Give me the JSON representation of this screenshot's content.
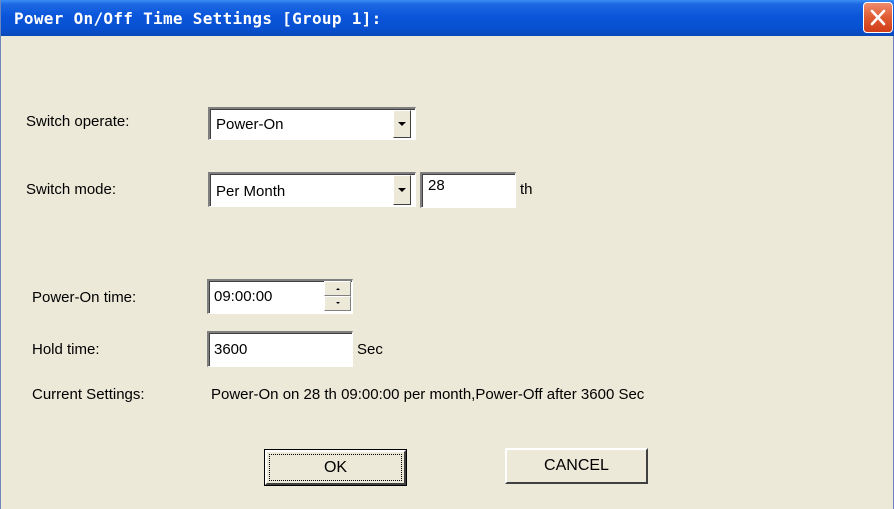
{
  "window": {
    "title": "Power On/Off Time Settings [Group 1]:"
  },
  "form": {
    "switch_operate_label": "Switch operate:",
    "switch_operate_value": "Power-On",
    "switch_mode_label": "Switch  mode:",
    "switch_mode_value": "Per Month",
    "day_value": "28",
    "day_suffix": "th",
    "power_on_time_label": "Power-On time:",
    "power_on_time_value": "09:00:00",
    "hold_time_label": "Hold time:",
    "hold_time_value": "3600",
    "hold_time_unit": "Sec",
    "current_settings_label": "Current Settings:",
    "current_settings_value": "Power-On on 28 th 09:00:00 per month,Power-Off after 3600 Sec"
  },
  "buttons": {
    "ok_label": "OK",
    "cancel_label": "CANCEL"
  },
  "icons": {
    "close": "close-icon",
    "dropdown": "chevron-down-icon",
    "spin_up": "spin-up-icon",
    "spin_down": "spin-down-icon"
  },
  "colors": {
    "titlebar": "#0a55da",
    "dialog_background": "#ece9d8",
    "close_button": "#e15b32"
  }
}
